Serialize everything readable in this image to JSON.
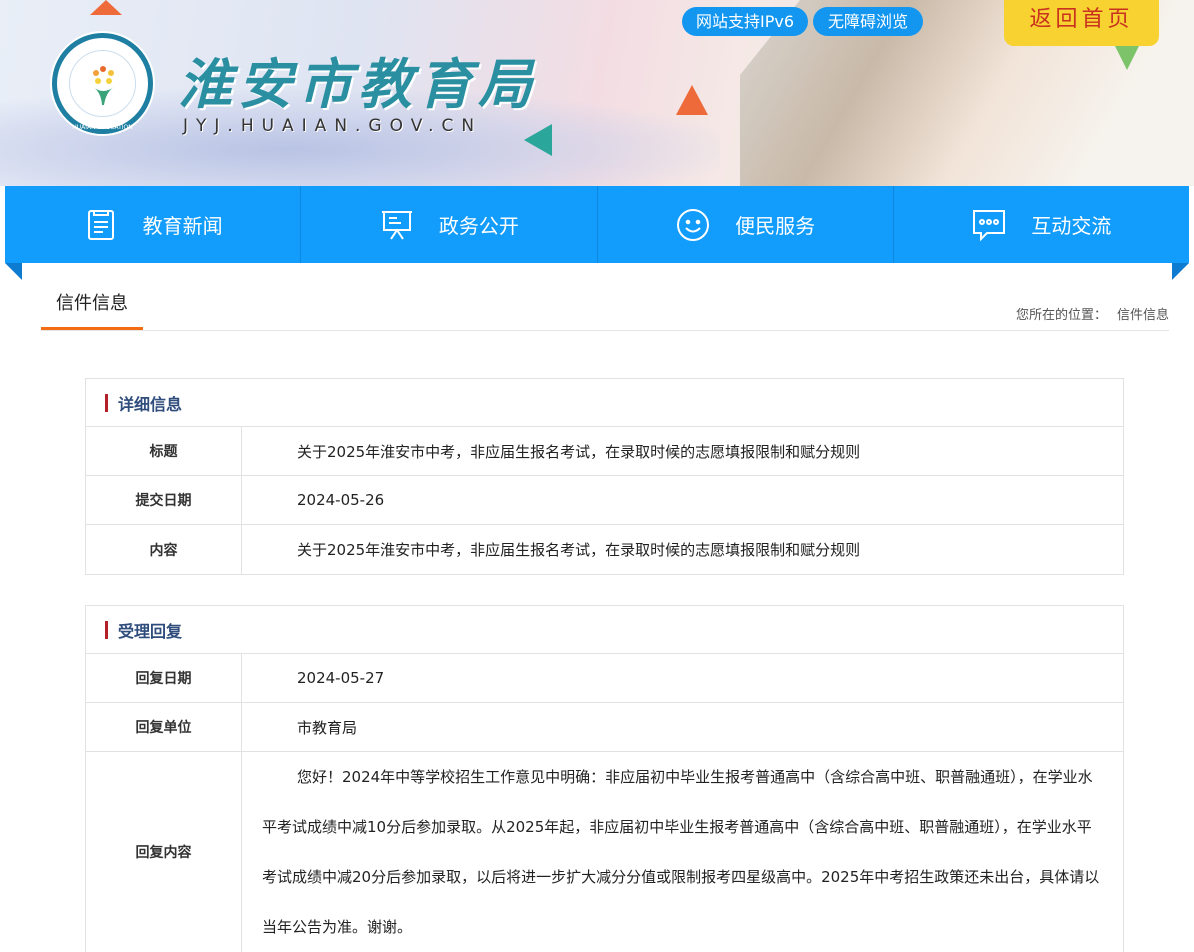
{
  "header": {
    "site_title": "淮安市教育局",
    "domain": "JYJ.HUAIAN.GOV.CN",
    "logo_text": "HUAIAN EDUCATION",
    "ipv6_label": "网站支持IPv6",
    "accessibility_label": "无障碍浏览",
    "home_label": "返回首页"
  },
  "nav": [
    {
      "label": "教育新闻",
      "icon": "news-icon"
    },
    {
      "label": "政务公开",
      "icon": "presentation-icon"
    },
    {
      "label": "便民服务",
      "icon": "smile-icon"
    },
    {
      "label": "互动交流",
      "icon": "chat-icon"
    }
  ],
  "page": {
    "tab": "信件信息",
    "breadcrumb_prefix": "您所在的位置：",
    "breadcrumb_current": "信件信息"
  },
  "details": {
    "heading": "详细信息",
    "rows": [
      {
        "label": "标题",
        "value": "关于2025年淮安市中考，非应届生报名考试，在录取时候的志愿填报限制和赋分规则"
      },
      {
        "label": "提交日期",
        "value": "2024-05-26"
      },
      {
        "label": "内容",
        "value": "关于2025年淮安市中考，非应届生报名考试，在录取时候的志愿填报限制和赋分规则"
      }
    ]
  },
  "reply": {
    "heading": "受理回复",
    "rows": [
      {
        "label": "回复日期",
        "value": "2024-05-27"
      },
      {
        "label": "回复单位",
        "value": "市教育局"
      },
      {
        "label": "回复内容",
        "value": "您好！2024年中等学校招生工作意见中明确：非应届初中毕业生报考普通高中（含综合高中班、职普融通班），在学业水平考试成绩中减10分后参加录取。从2025年起，非应届初中毕业生报考普通高中（含综合高中班、职普融通班），在学业水平考试成绩中减20分后参加录取，以后将进一步扩大减分分值或限制报考四星级高中。2025年中考招生政策还未出台，具体请以当年公告为准。谢谢。"
      }
    ]
  },
  "colors": {
    "nav": "#129cfc",
    "accent": "#f36b12",
    "home_bg": "#f8d230",
    "section_bar": "#b3202a"
  }
}
